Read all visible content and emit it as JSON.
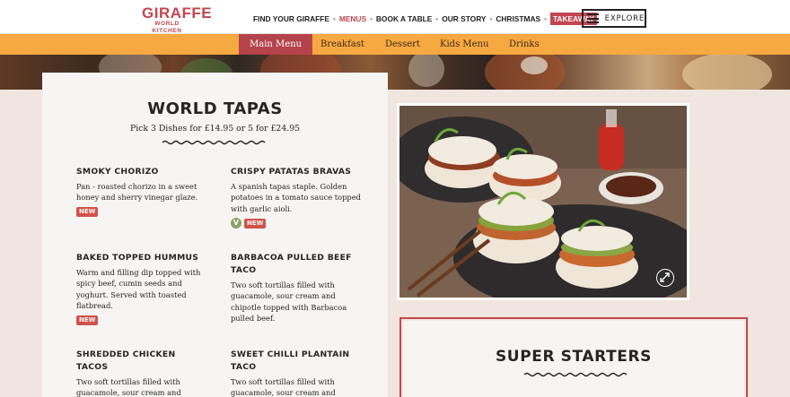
{
  "header": {
    "logo_line1": "GIRAFFE",
    "logo_line2": "WORLD KITCHEN",
    "nav": [
      {
        "label": "FIND YOUR GIRAFFE"
      },
      {
        "label": "MENUS"
      },
      {
        "label": "BOOK A TABLE"
      },
      {
        "label": "OUR STORY"
      },
      {
        "label": "CHRISTMAS"
      },
      {
        "label": "TAKEAWAY"
      }
    ],
    "active_nav": "MENUS",
    "explore_label": "EXPLORE"
  },
  "subnav": {
    "tabs": [
      {
        "label": "Main Menu"
      },
      {
        "label": "Breakfast"
      },
      {
        "label": "Dessert"
      },
      {
        "label": "Kids Menu"
      },
      {
        "label": "Drinks"
      }
    ],
    "active_tab": "Main Menu"
  },
  "world_tapas": {
    "title": "WORLD TAPAS",
    "subtitle": "Pick 3 Dishes for £14.95 or 5 for £24.95",
    "dishes": [
      {
        "name": "SMOKY CHORIZO",
        "desc": "Pan - roasted chorizo in a sweet honey and sherry vinegar glaze.",
        "vegetarian": false,
        "new": true,
        "new_label": "NEW"
      },
      {
        "name": "CRISPY PATATAS BRAVAS",
        "desc": "A spanish tapas staple. Golden potatoes in a tomato sauce topped with garlic aioli.",
        "vegetarian": true,
        "veg_label": "V",
        "new": true,
        "new_label": "NEW"
      },
      {
        "name": "BAKED TOPPED HUMMUS",
        "desc": "Warm and filling dip topped with spicy beef, cumin seeds and yoghurt. Served with toasted flatbread.",
        "vegetarian": false,
        "new": true,
        "new_label": "NEW"
      },
      {
        "name": "BARBACOA PULLED BEEF TACO",
        "desc": "Two soft tortillas filled with guacamole, sour cream and chipotle topped with Barbacoa pulled beef.",
        "vegetarian": false,
        "new": false
      },
      {
        "name": "SHREDDED CHICKEN TACOS",
        "desc": "Two soft tortillas filled with guacamole, sour cream and chipotle topped with shredded",
        "vegetarian": false,
        "new": false
      },
      {
        "name": "SWEET CHILLI PLANTAIN TACO",
        "desc": "Two soft tortillas filled with guacamole, sour cream and",
        "vegetarian": false,
        "new": false
      }
    ]
  },
  "photo": {
    "expand_icon": "expand-arrows-icon"
  },
  "super_starters": {
    "title": "SUPER STARTERS"
  },
  "colors": {
    "brand_red": "#c2464f",
    "subnav_orange": "#f7a941",
    "new_badge": "#d25248",
    "veg_badge": "#8aa067",
    "page_bg": "#f1e6df"
  }
}
